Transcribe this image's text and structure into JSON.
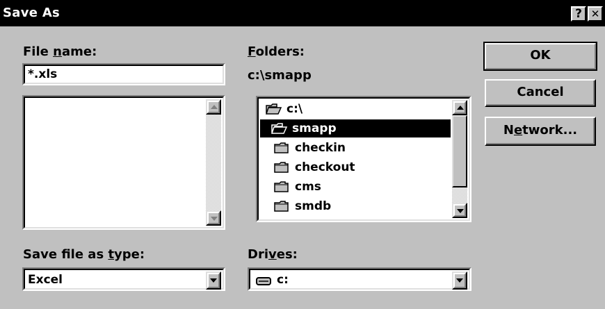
{
  "window": {
    "title": "Save As",
    "help_label": "?",
    "close_label": "✕"
  },
  "filename": {
    "label_pre": "File ",
    "label_u": "n",
    "label_post": "ame:",
    "value": "*.xls",
    "list": []
  },
  "folders": {
    "label_u": "F",
    "label_post": "olders:",
    "current_path": "c:\\smapp",
    "items": [
      {
        "name": "c:\\",
        "icon": "open-folder-icon",
        "indent": 0,
        "selected": false
      },
      {
        "name": "smapp",
        "icon": "open-folder-icon",
        "indent": 1,
        "selected": true
      },
      {
        "name": "checkin",
        "icon": "folder-icon",
        "indent": 2,
        "selected": false
      },
      {
        "name": "checkout",
        "icon": "folder-icon",
        "indent": 2,
        "selected": false
      },
      {
        "name": "cms",
        "icon": "folder-icon",
        "indent": 2,
        "selected": false
      },
      {
        "name": "smdb",
        "icon": "folder-icon",
        "indent": 2,
        "selected": false
      }
    ]
  },
  "buttons": {
    "ok": "OK",
    "cancel": "Cancel",
    "network_pre": "N",
    "network_u": "e",
    "network_post": "twork..."
  },
  "save_type": {
    "label_pre": "Save file as ",
    "label_u": "t",
    "label_post": "ype:",
    "value": "Excel"
  },
  "drives": {
    "label_pre": "Dri",
    "label_u": "v",
    "label_post": "es:",
    "value": "c:",
    "icon": "drive-icon"
  }
}
